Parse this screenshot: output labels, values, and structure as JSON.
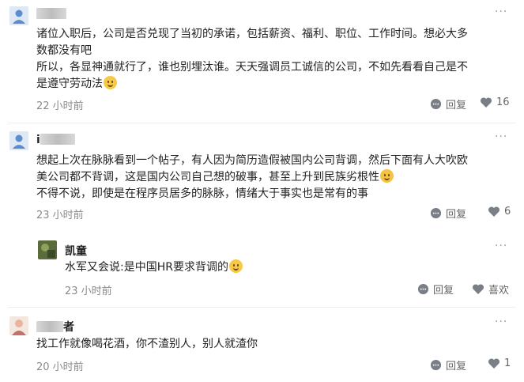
{
  "comments": [
    {
      "author": "",
      "text": [
        "诸位入职后，公司是否兑现了当初的承诺，包括薪资、福利、职位、工作时间。想必大多",
        "数都没有吧",
        "所以，各显神通就行了，谁也别埋汰谁。天天强调员工诚信的公司，不如先看看自己是不",
        "是遵守劳动法"
      ],
      "time": "22 小时前",
      "reply_label": "回复",
      "like_count": "16"
    },
    {
      "author": "i",
      "text": [
        "想起上次在脉脉看到一个帖子，有人因为简历造假被国内公司背调，然后下面有人大吹欧",
        "美公司都不背调，这是国内公司自己想的破事，甚至上升到民族劣根性",
        "不得不说，即使是在程序员居多的脉脉，情绪大于事实也是常有的事"
      ],
      "time": "23 小时前",
      "reply_label": "回复",
      "like_count": "6"
    },
    {
      "author": "凯童",
      "text": [
        "水军又会说:是中国HR要求背调的"
      ],
      "time": "23 小时前",
      "reply_label": "回复",
      "like_label": "喜欢"
    },
    {
      "author": "者",
      "text": [
        "找工作就像喝花酒，你不渣别人，别人就渣你"
      ],
      "time": "20 小时前",
      "reply_label": "回复",
      "like_count": "1"
    }
  ],
  "icons": {
    "more": "more-icon",
    "reply": "comment-bubble-icon",
    "like": "heart-icon"
  },
  "colors": {
    "icon": "#7a7f87",
    "text": "#222222",
    "muted": "#8a8a8a"
  }
}
